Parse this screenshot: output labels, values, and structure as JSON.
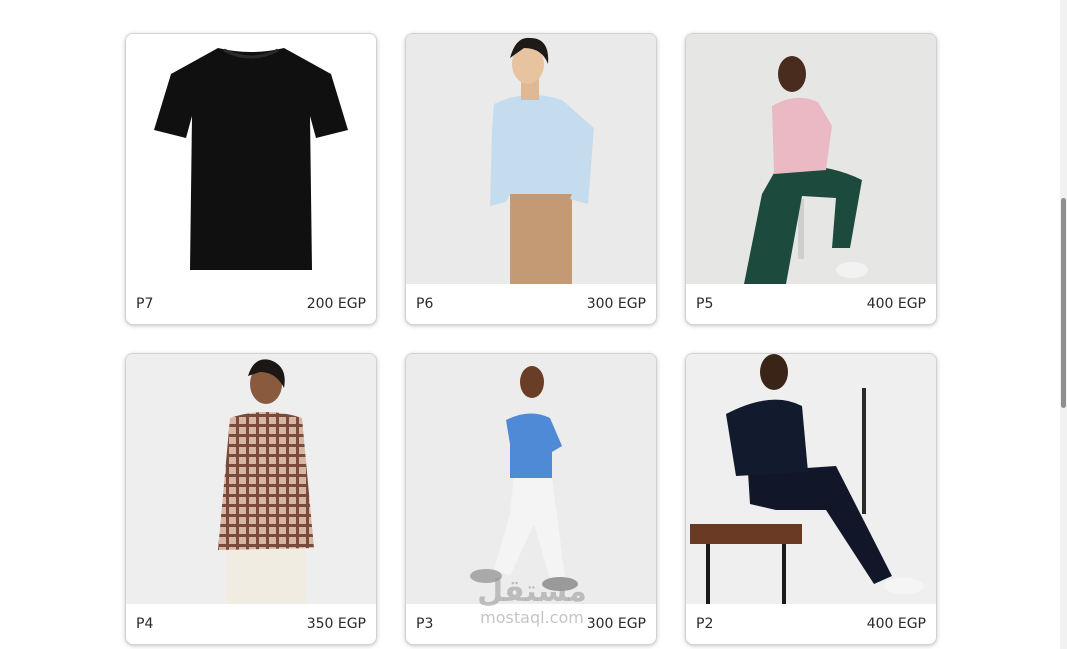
{
  "colors": {
    "card_bg": "#ffffff",
    "photo_bg": "#ededed",
    "text": "#2a2a2a"
  },
  "products": [
    {
      "name": "P7",
      "price": "200 EGP",
      "image": "black-tshirt"
    },
    {
      "name": "P6",
      "price": "300 EGP",
      "image": "man-light-blue-shirt-tan-pants"
    },
    {
      "name": "P5",
      "price": "400 EGP",
      "image": "man-pink-shirt-green-pants-seated"
    },
    {
      "name": "P4",
      "price": "350 EGP",
      "image": "man-plaid-shirt-cream-pants"
    },
    {
      "name": "P3",
      "price": "300 EGP",
      "image": "man-blue-tshirt-white-pants-walking"
    },
    {
      "name": "P2",
      "price": "400 EGP",
      "image": "man-navy-polo-on-bench"
    }
  ],
  "watermark": {
    "logo": "مستقل",
    "text": "mostaql.com"
  }
}
